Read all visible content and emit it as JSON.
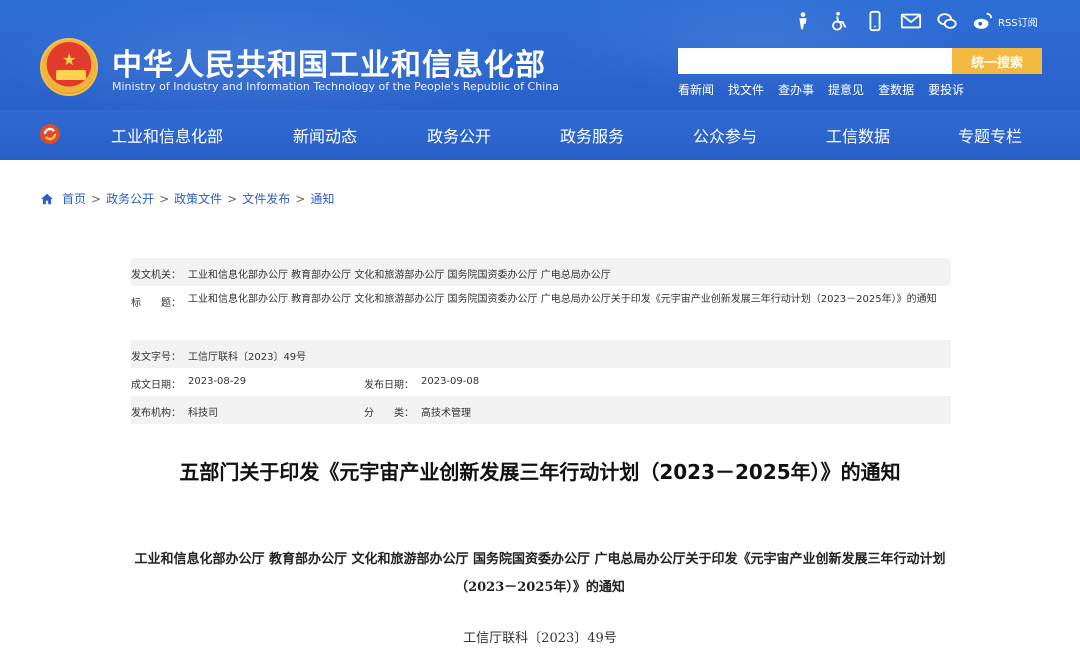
{
  "header": {
    "title": "中华人民共和国工业和信息化部",
    "subtitle": "Ministry of Industry and Information Technology of the People's Republic of China",
    "rss_label": "RSS订阅",
    "search": {
      "placeholder": "",
      "button_label": "统一搜索"
    },
    "quick_links": [
      "看新闻",
      "找文件",
      "查办事",
      "提意见",
      "查数据",
      "要投诉"
    ],
    "util_icons": [
      "elder-care-icon",
      "accessibility-icon",
      "mobile-icon",
      "mail-icon",
      "wechat-icon",
      "weibo-icon"
    ]
  },
  "nav": {
    "items": [
      "工业和信息化部",
      "新闻动态",
      "政务公开",
      "政务服务",
      "公众参与",
      "工信数据",
      "专题专栏"
    ]
  },
  "breadcrumb": {
    "items": [
      "首页",
      "政务公开",
      "政策文件",
      "文件发布",
      "通知"
    ],
    "separator": ">"
  },
  "info": {
    "issuer_label": "发文机关：",
    "issuer_value": "工业和信息化部办公厅 教育部办公厅 文化和旅游部办公厅 国务院国资委办公厅 广电总局办公厅",
    "title_label": "标　　题：",
    "title_value": "工业和信息化部办公厅 教育部办公厅 文化和旅游部办公厅 国务院国资委办公厅 广电总局办公厅关于印发《元宇宙产业创新发展三年行动计划（2023－2025年）》的通知",
    "docno_label": "发文字号：",
    "docno_value": "工信厅联科〔2023〕49号",
    "written_label": "成文日期：",
    "written_value": "2023-08-29",
    "published_label": "发布日期：",
    "published_value": "2023-09-08",
    "org_label": "发布机构：",
    "org_value": "科技司",
    "category_label": "分　　类：",
    "category_value": "高技术管理"
  },
  "doc": {
    "title": "五部门关于印发《元宇宙产业创新发展三年行动计划（2023－2025年）》的通知",
    "heading": "工业和信息化部办公厅 教育部办公厅 文化和旅游部办公厅 国务院国资委办公厅 广电总局办公厅关于印发《元宇宙产业创新发展三年行动计划（2023－2025年）》的通知",
    "number": "工信厅联科〔2023〕49号"
  },
  "colors": {
    "header_blue": "#2a63cc",
    "search_button": "#f3b941",
    "link_blue": "#2a5fc7",
    "row_shade": "#f2f2f2"
  }
}
